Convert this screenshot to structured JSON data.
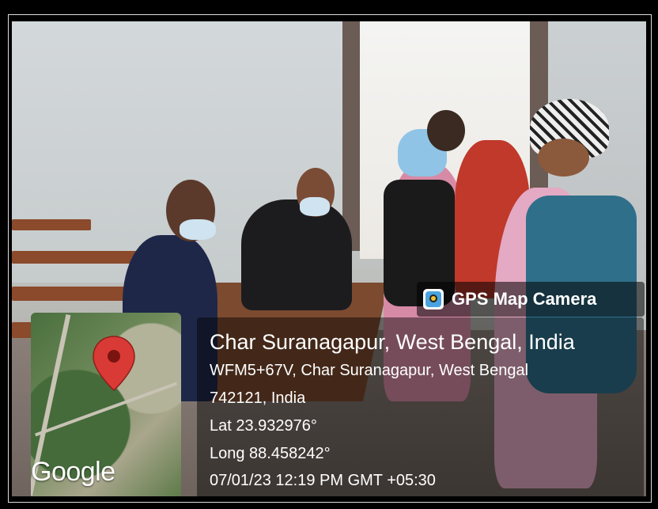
{
  "badge": {
    "app_name": "GPS Map Camera"
  },
  "location": {
    "title": "Char Suranagapur, West Bengal, India",
    "address_line1": "WFM5+67V, Char Suranagapur, West Bengal",
    "address_line2": "742121, India",
    "lat": "Lat 23.932976°",
    "long": "Long 88.458242°",
    "timestamp": "07/01/23 12:19 PM GMT +05:30"
  },
  "map": {
    "attribution": "Google",
    "pin_color": "#d93a35"
  }
}
